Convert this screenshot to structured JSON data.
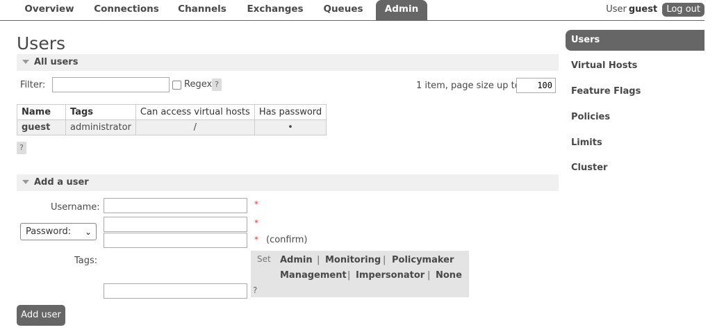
{
  "nav": {
    "tabs": [
      {
        "label": "Overview"
      },
      {
        "label": "Connections"
      },
      {
        "label": "Channels"
      },
      {
        "label": "Exchanges"
      },
      {
        "label": "Queues"
      },
      {
        "label": "Admin",
        "active": true
      }
    ],
    "user_label": "User",
    "user_name": "guest",
    "logout_label": "Log out"
  },
  "page_title": "Users",
  "all_users": {
    "header": "All users",
    "filter_label": "Filter:",
    "filter_value": "",
    "regex_label": "Regex",
    "regex_checked": false,
    "help": "?",
    "paging_text": "1 item, page size up to",
    "page_size": "100",
    "table": {
      "columns": [
        "Name",
        "Tags",
        "Can access virtual hosts",
        "Has password"
      ],
      "rows": [
        {
          "name": "guest",
          "tags": "administrator",
          "vhosts": "/",
          "has_password": "•"
        }
      ]
    },
    "table_help": "?"
  },
  "add_user": {
    "header": "Add a user",
    "username_label": "Username:",
    "password_option": "Password:",
    "required_mark": "*",
    "confirm_label": "(confirm)",
    "tags_label": "Tags:",
    "set_label": "Set",
    "tag_options": [
      "Admin",
      "Monitoring",
      "Policymaker",
      "Management",
      "Impersonator",
      "None"
    ],
    "separator": "|",
    "tags_help": "?",
    "submit_label": "Add user"
  },
  "sidebar": {
    "items": [
      {
        "label": "Users",
        "active": true
      },
      {
        "label": "Virtual Hosts"
      },
      {
        "label": "Feature Flags"
      },
      {
        "label": "Policies"
      },
      {
        "label": "Limits"
      },
      {
        "label": "Cluster"
      }
    ]
  },
  "colors": {
    "accent": "#666666",
    "section_bg": "#f0f0f0",
    "required": "#ee3333"
  }
}
